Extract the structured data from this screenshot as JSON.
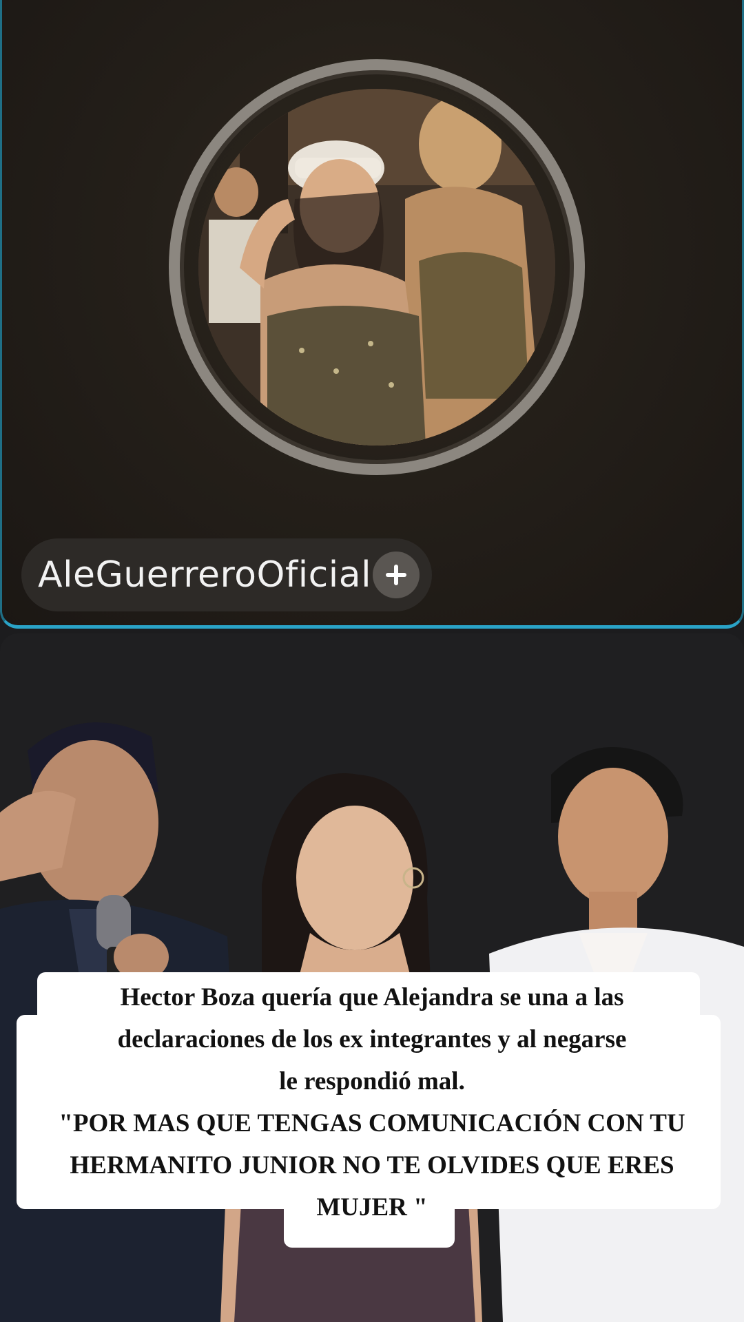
{
  "profile": {
    "username": "AleGuerreroOficial",
    "follow_icon": "plus-icon",
    "ring_color": "#8c8780",
    "panel_border_color": "#2aa3c7"
  },
  "caption": {
    "lines": [
      "Hector Boza quería que Alejandra se una a las",
      "declaraciones de los ex integrantes y al negarse",
      "le respondió mal.",
      "\"POR MAS QUE TENGAS COMUNICACIÓN CON TU",
      "HERMANITO JUNIOR NO TE OLVIDES QUE ERES",
      "MUJER \""
    ]
  }
}
